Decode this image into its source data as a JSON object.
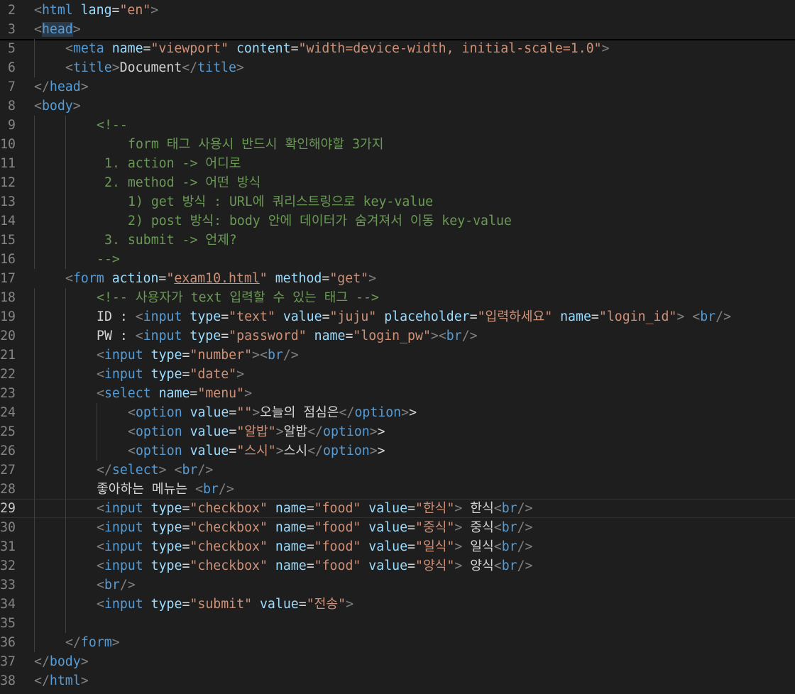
{
  "editor": {
    "first_line": 2,
    "current_line": 29,
    "lines": [
      {
        "n": 2,
        "indent": 0,
        "parts": [
          [
            "p",
            "<"
          ],
          [
            "t",
            "html"
          ],
          [
            "x",
            " "
          ],
          [
            "a",
            "lang"
          ],
          [
            "x",
            "="
          ],
          [
            "s",
            "\"en\""
          ],
          [
            "p",
            ">"
          ]
        ]
      },
      {
        "n": 3,
        "indent": 0,
        "parts": [
          [
            "p",
            "<"
          ],
          [
            "t",
            "head"
          ],
          [
            "p",
            ">"
          ]
        ],
        "hl": true,
        "sep": true
      },
      {
        "n": 5,
        "indent": 4,
        "parts": [
          [
            "p",
            "<"
          ],
          [
            "t",
            "meta"
          ],
          [
            "x",
            " "
          ],
          [
            "a",
            "name"
          ],
          [
            "x",
            "="
          ],
          [
            "s",
            "\"viewport\""
          ],
          [
            "x",
            " "
          ],
          [
            "a",
            "content"
          ],
          [
            "x",
            "="
          ],
          [
            "s",
            "\"width=device-width, initial-scale=1.0\""
          ],
          [
            "p",
            ">"
          ]
        ]
      },
      {
        "n": 6,
        "indent": 4,
        "parts": [
          [
            "p",
            "<"
          ],
          [
            "t",
            "title"
          ],
          [
            "p",
            ">"
          ],
          [
            "x",
            "Document"
          ],
          [
            "p",
            "</"
          ],
          [
            "t",
            "title"
          ],
          [
            "p",
            ">"
          ]
        ]
      },
      {
        "n": 7,
        "indent": 0,
        "parts": [
          [
            "p",
            "</"
          ],
          [
            "t",
            "head"
          ],
          [
            "p",
            ">"
          ]
        ]
      },
      {
        "n": 8,
        "indent": 0,
        "parts": [
          [
            "p",
            "<"
          ],
          [
            "t",
            "body"
          ],
          [
            "p",
            ">"
          ]
        ]
      },
      {
        "n": 9,
        "indent": 8,
        "parts": [
          [
            "c",
            "<!--"
          ]
        ]
      },
      {
        "n": 10,
        "indent": 12,
        "parts": [
          [
            "c",
            "form 태그 사용시 반드시 확인해야할 3가지"
          ]
        ]
      },
      {
        "n": 11,
        "indent": 9,
        "parts": [
          [
            "c",
            "1. action -> 어디로"
          ]
        ]
      },
      {
        "n": 12,
        "indent": 9,
        "parts": [
          [
            "c",
            "2. method -> 어떤 방식"
          ]
        ]
      },
      {
        "n": 13,
        "indent": 12,
        "parts": [
          [
            "c",
            "1) get 방식 : URL에 쿼리스트링으로 key-value"
          ]
        ]
      },
      {
        "n": 14,
        "indent": 12,
        "parts": [
          [
            "c",
            "2) post 방식: body 안에 데이터가 숨겨져서 이동 key-value"
          ]
        ]
      },
      {
        "n": 15,
        "indent": 9,
        "parts": [
          [
            "c",
            "3. submit -> 언제?"
          ]
        ]
      },
      {
        "n": 16,
        "indent": 8,
        "parts": [
          [
            "c",
            "-->"
          ]
        ]
      },
      {
        "n": 17,
        "indent": 4,
        "parts": [
          [
            "p",
            "<"
          ],
          [
            "t",
            "form"
          ],
          [
            "x",
            " "
          ],
          [
            "a",
            "action"
          ],
          [
            "x",
            "="
          ],
          [
            "s",
            "\""
          ],
          [
            "sl",
            "exam10.html"
          ],
          [
            "s",
            "\""
          ],
          [
            "x",
            " "
          ],
          [
            "a",
            "method"
          ],
          [
            "x",
            "="
          ],
          [
            "s",
            "\"get\""
          ],
          [
            "p",
            ">"
          ]
        ]
      },
      {
        "n": 18,
        "indent": 8,
        "parts": [
          [
            "c",
            "<!-- 사용자가 text 입력할 수 있는 태그 -->"
          ]
        ]
      },
      {
        "n": 19,
        "indent": 8,
        "parts": [
          [
            "x",
            "ID : "
          ],
          [
            "p",
            "<"
          ],
          [
            "t",
            "input"
          ],
          [
            "x",
            " "
          ],
          [
            "a",
            "type"
          ],
          [
            "x",
            "="
          ],
          [
            "s",
            "\"text\""
          ],
          [
            "x",
            " "
          ],
          [
            "a",
            "value"
          ],
          [
            "x",
            "="
          ],
          [
            "s",
            "\"juju\""
          ],
          [
            "x",
            " "
          ],
          [
            "a",
            "placeholder"
          ],
          [
            "x",
            "="
          ],
          [
            "s",
            "\"입력하세요\""
          ],
          [
            "x",
            " "
          ],
          [
            "a",
            "name"
          ],
          [
            "x",
            "="
          ],
          [
            "s",
            "\"login_id\""
          ],
          [
            "p",
            ">"
          ],
          [
            "x",
            " "
          ],
          [
            "p",
            "<"
          ],
          [
            "t",
            "br"
          ],
          [
            "p",
            "/>"
          ]
        ]
      },
      {
        "n": 20,
        "indent": 8,
        "parts": [
          [
            "x",
            "PW : "
          ],
          [
            "p",
            "<"
          ],
          [
            "t",
            "input"
          ],
          [
            "x",
            " "
          ],
          [
            "a",
            "type"
          ],
          [
            "x",
            "="
          ],
          [
            "s",
            "\"password\""
          ],
          [
            "x",
            " "
          ],
          [
            "a",
            "name"
          ],
          [
            "x",
            "="
          ],
          [
            "s",
            "\"login_pw\""
          ],
          [
            "p",
            ">"
          ],
          [
            "p",
            "<"
          ],
          [
            "t",
            "br"
          ],
          [
            "p",
            "/>"
          ]
        ]
      },
      {
        "n": 21,
        "indent": 8,
        "parts": [
          [
            "p",
            "<"
          ],
          [
            "t",
            "input"
          ],
          [
            "x",
            " "
          ],
          [
            "a",
            "type"
          ],
          [
            "x",
            "="
          ],
          [
            "s",
            "\"number\""
          ],
          [
            "p",
            ">"
          ],
          [
            "p",
            "<"
          ],
          [
            "t",
            "br"
          ],
          [
            "p",
            "/>"
          ]
        ]
      },
      {
        "n": 22,
        "indent": 8,
        "parts": [
          [
            "p",
            "<"
          ],
          [
            "t",
            "input"
          ],
          [
            "x",
            " "
          ],
          [
            "a",
            "type"
          ],
          [
            "x",
            "="
          ],
          [
            "s",
            "\"date\""
          ],
          [
            "p",
            ">"
          ]
        ]
      },
      {
        "n": 23,
        "indent": 8,
        "parts": [
          [
            "p",
            "<"
          ],
          [
            "t",
            "select"
          ],
          [
            "x",
            " "
          ],
          [
            "a",
            "name"
          ],
          [
            "x",
            "="
          ],
          [
            "s",
            "\"menu\""
          ],
          [
            "p",
            ">"
          ]
        ]
      },
      {
        "n": 24,
        "indent": 12,
        "parts": [
          [
            "p",
            "<"
          ],
          [
            "t",
            "option"
          ],
          [
            "x",
            " "
          ],
          [
            "a",
            "value"
          ],
          [
            "x",
            "="
          ],
          [
            "s",
            "\"\""
          ],
          [
            "p",
            ">"
          ],
          [
            "x",
            "오늘의 점심은"
          ],
          [
            "p",
            "</"
          ],
          [
            "t",
            "option"
          ],
          [
            "p",
            ">"
          ],
          [
            "x",
            ">"
          ]
        ]
      },
      {
        "n": 25,
        "indent": 12,
        "parts": [
          [
            "p",
            "<"
          ],
          [
            "t",
            "option"
          ],
          [
            "x",
            " "
          ],
          [
            "a",
            "value"
          ],
          [
            "x",
            "="
          ],
          [
            "s",
            "\"알밥\""
          ],
          [
            "p",
            ">"
          ],
          [
            "x",
            "알밥"
          ],
          [
            "p",
            "</"
          ],
          [
            "t",
            "option"
          ],
          [
            "p",
            ">"
          ],
          [
            "x",
            ">"
          ]
        ]
      },
      {
        "n": 26,
        "indent": 12,
        "parts": [
          [
            "p",
            "<"
          ],
          [
            "t",
            "option"
          ],
          [
            "x",
            " "
          ],
          [
            "a",
            "value"
          ],
          [
            "x",
            "="
          ],
          [
            "s",
            "\"스시\""
          ],
          [
            "p",
            ">"
          ],
          [
            "x",
            "스시"
          ],
          [
            "p",
            "</"
          ],
          [
            "t",
            "option"
          ],
          [
            "p",
            ">"
          ],
          [
            "x",
            ">"
          ]
        ]
      },
      {
        "n": 27,
        "indent": 8,
        "parts": [
          [
            "p",
            "</"
          ],
          [
            "t",
            "select"
          ],
          [
            "p",
            ">"
          ],
          [
            "x",
            " "
          ],
          [
            "p",
            "<"
          ],
          [
            "t",
            "br"
          ],
          [
            "p",
            "/>"
          ]
        ]
      },
      {
        "n": 28,
        "indent": 8,
        "parts": [
          [
            "x",
            "좋아하는 메뉴는 "
          ],
          [
            "p",
            "<"
          ],
          [
            "t",
            "br"
          ],
          [
            "p",
            "/>"
          ]
        ]
      },
      {
        "n": 29,
        "indent": 8,
        "parts": [
          [
            "p",
            "<"
          ],
          [
            "t",
            "input"
          ],
          [
            "x",
            " "
          ],
          [
            "a",
            "type"
          ],
          [
            "x",
            "="
          ],
          [
            "s",
            "\"checkbox\""
          ],
          [
            "x",
            " "
          ],
          [
            "a",
            "name"
          ],
          [
            "x",
            "="
          ],
          [
            "s",
            "\"food\""
          ],
          [
            "x",
            " "
          ],
          [
            "a",
            "value"
          ],
          [
            "x",
            "="
          ],
          [
            "s",
            "\"한식\""
          ],
          [
            "p",
            ">"
          ],
          [
            "x",
            " 한식"
          ],
          [
            "p",
            "<"
          ],
          [
            "t",
            "br"
          ],
          [
            "p",
            "/>"
          ]
        ]
      },
      {
        "n": 30,
        "indent": 8,
        "parts": [
          [
            "p",
            "<"
          ],
          [
            "t",
            "input"
          ],
          [
            "x",
            " "
          ],
          [
            "a",
            "type"
          ],
          [
            "x",
            "="
          ],
          [
            "s",
            "\"checkbox\""
          ],
          [
            "x",
            " "
          ],
          [
            "a",
            "name"
          ],
          [
            "x",
            "="
          ],
          [
            "s",
            "\"food\""
          ],
          [
            "x",
            " "
          ],
          [
            "a",
            "value"
          ],
          [
            "x",
            "="
          ],
          [
            "s",
            "\"중식\""
          ],
          [
            "p",
            ">"
          ],
          [
            "x",
            " 중식"
          ],
          [
            "p",
            "<"
          ],
          [
            "t",
            "br"
          ],
          [
            "p",
            "/>"
          ]
        ]
      },
      {
        "n": 31,
        "indent": 8,
        "parts": [
          [
            "p",
            "<"
          ],
          [
            "t",
            "input"
          ],
          [
            "x",
            " "
          ],
          [
            "a",
            "type"
          ],
          [
            "x",
            "="
          ],
          [
            "s",
            "\"checkbox\""
          ],
          [
            "x",
            " "
          ],
          [
            "a",
            "name"
          ],
          [
            "x",
            "="
          ],
          [
            "s",
            "\"food\""
          ],
          [
            "x",
            " "
          ],
          [
            "a",
            "value"
          ],
          [
            "x",
            "="
          ],
          [
            "s",
            "\"일식\""
          ],
          [
            "p",
            ">"
          ],
          [
            "x",
            " 일식"
          ],
          [
            "p",
            "<"
          ],
          [
            "t",
            "br"
          ],
          [
            "p",
            "/>"
          ]
        ]
      },
      {
        "n": 32,
        "indent": 8,
        "parts": [
          [
            "p",
            "<"
          ],
          [
            "t",
            "input"
          ],
          [
            "x",
            " "
          ],
          [
            "a",
            "type"
          ],
          [
            "x",
            "="
          ],
          [
            "s",
            "\"checkbox\""
          ],
          [
            "x",
            " "
          ],
          [
            "a",
            "name"
          ],
          [
            "x",
            "="
          ],
          [
            "s",
            "\"food\""
          ],
          [
            "x",
            " "
          ],
          [
            "a",
            "value"
          ],
          [
            "x",
            "="
          ],
          [
            "s",
            "\"양식\""
          ],
          [
            "p",
            ">"
          ],
          [
            "x",
            " 양식"
          ],
          [
            "p",
            "<"
          ],
          [
            "t",
            "br"
          ],
          [
            "p",
            "/>"
          ]
        ]
      },
      {
        "n": 33,
        "indent": 8,
        "parts": [
          [
            "p",
            "<"
          ],
          [
            "t",
            "br"
          ],
          [
            "p",
            "/>"
          ]
        ]
      },
      {
        "n": 34,
        "indent": 8,
        "parts": [
          [
            "p",
            "<"
          ],
          [
            "t",
            "input"
          ],
          [
            "x",
            " "
          ],
          [
            "a",
            "type"
          ],
          [
            "x",
            "="
          ],
          [
            "s",
            "\"submit\""
          ],
          [
            "x",
            " "
          ],
          [
            "a",
            "value"
          ],
          [
            "x",
            "="
          ],
          [
            "s",
            "\"전송\""
          ],
          [
            "p",
            ">"
          ]
        ]
      },
      {
        "n": 35,
        "indent": 0,
        "parts": []
      },
      {
        "n": 36,
        "indent": 4,
        "parts": [
          [
            "p",
            "</"
          ],
          [
            "t",
            "form"
          ],
          [
            "p",
            ">"
          ]
        ]
      },
      {
        "n": 37,
        "indent": 0,
        "parts": [
          [
            "p",
            "</"
          ],
          [
            "t",
            "body"
          ],
          [
            "p",
            ">"
          ]
        ]
      },
      {
        "n": 38,
        "indent": 0,
        "parts": [
          [
            "p",
            "</"
          ],
          [
            "t",
            "html"
          ],
          [
            "p",
            ">"
          ]
        ]
      }
    ]
  }
}
